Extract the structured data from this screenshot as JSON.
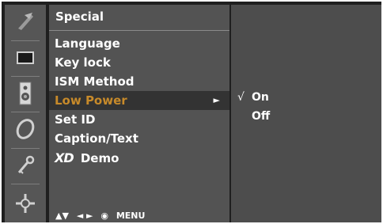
{
  "menu": {
    "title": "Special",
    "items": [
      {
        "label": "Language"
      },
      {
        "label": "Key lock"
      },
      {
        "label": "ISM Method"
      },
      {
        "label": "Low Power",
        "selected": true,
        "arrow": "►"
      },
      {
        "label": "Set ID"
      },
      {
        "label": "Caption/Text"
      },
      {
        "label": "Demo",
        "logo": "XD"
      }
    ]
  },
  "nav_hint": {
    "updown": "▲▼",
    "leftright": "◄ ►",
    "ok": "◉",
    "menu": "MENU"
  },
  "submenu": {
    "options": [
      {
        "label": "On",
        "check": "√",
        "checked": true
      },
      {
        "label": "Off",
        "check": "",
        "checked": false
      }
    ]
  },
  "icons": [
    "picture-settings-icon",
    "screen-icon",
    "speaker-icon",
    "timer-icon",
    "key-icon",
    "input-icon"
  ],
  "colors": {
    "background": "#1f1f1f",
    "menu_panel": "#535353",
    "highlight_bar": "#333333",
    "highlight_text": "#c78a2a"
  }
}
